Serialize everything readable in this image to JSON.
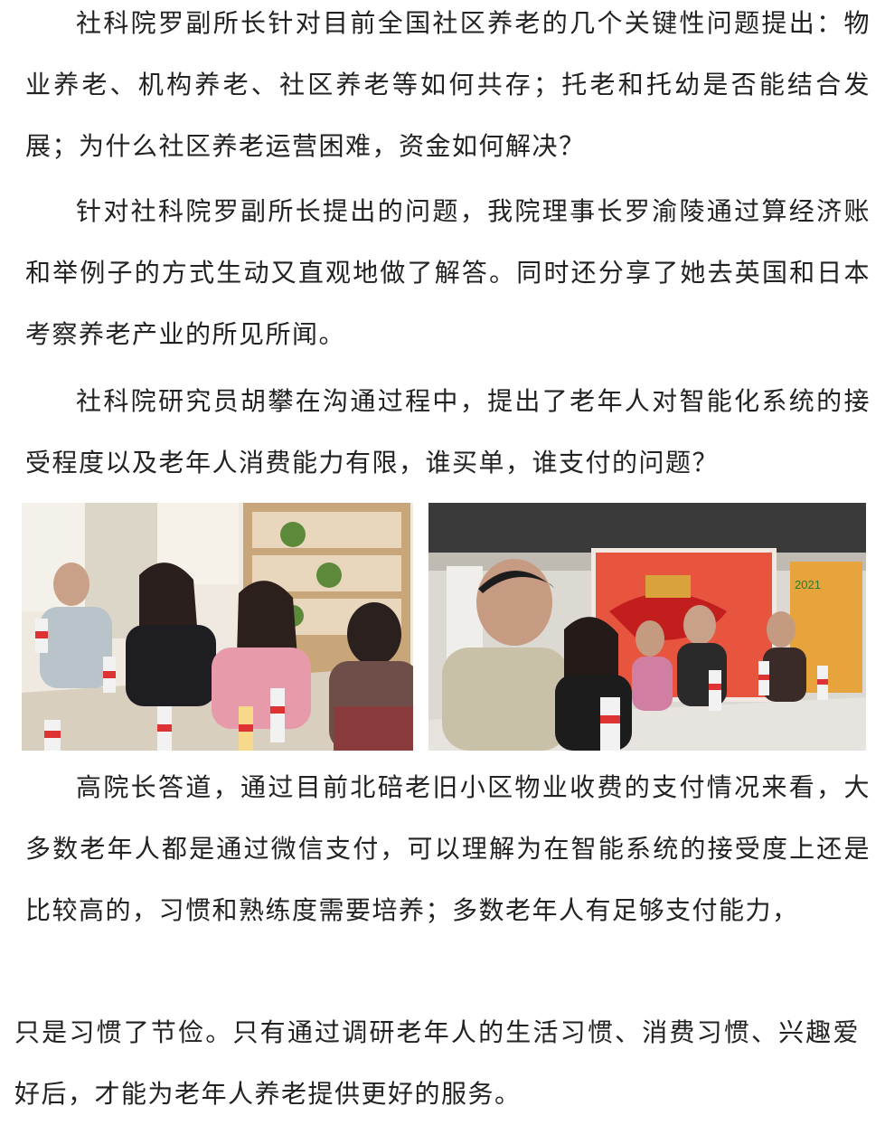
{
  "paragraphs": {
    "p1": "社科院罗副所长针对目前全国社区养老的几个关键性问题提出：物业养老、机构养老、社区养老等如何共存；托老和托幼是否能结合发展；为什么社区养老运营困难，资金如何解决？",
    "p2": "针对社科院罗副所长提出的问题，我院理事长罗渝陵通过算经济账和举例子的方式生动又直观地做了解答。同时还分享了她去英国和日本考察养老产业的所见所闻。",
    "p3": "社科院研究员胡攀在沟通过程中，提出了老年人对智能化系统的接受程度以及老年人消费能力有限，谁买单，谁支付的问题？",
    "p4": "高院长答道，通过目前北碚老旧小区物业收费的支付情况来看，大多数老年人都是通过微信支付，可以理解为在智能系统的接受度上还是比较高的，习惯和熟练度需要培养；多数老年人有足够支付能力，",
    "p5": "只是习惯了节俭。只有通过调研老年人的生活习惯、消费习惯、兴趣爱好后，才能为老年人养老提供更好的服务。"
  },
  "photos": {
    "left": "meeting-photo-bookshelf",
    "right": "meeting-photo-banner"
  },
  "banner_text": "2021"
}
